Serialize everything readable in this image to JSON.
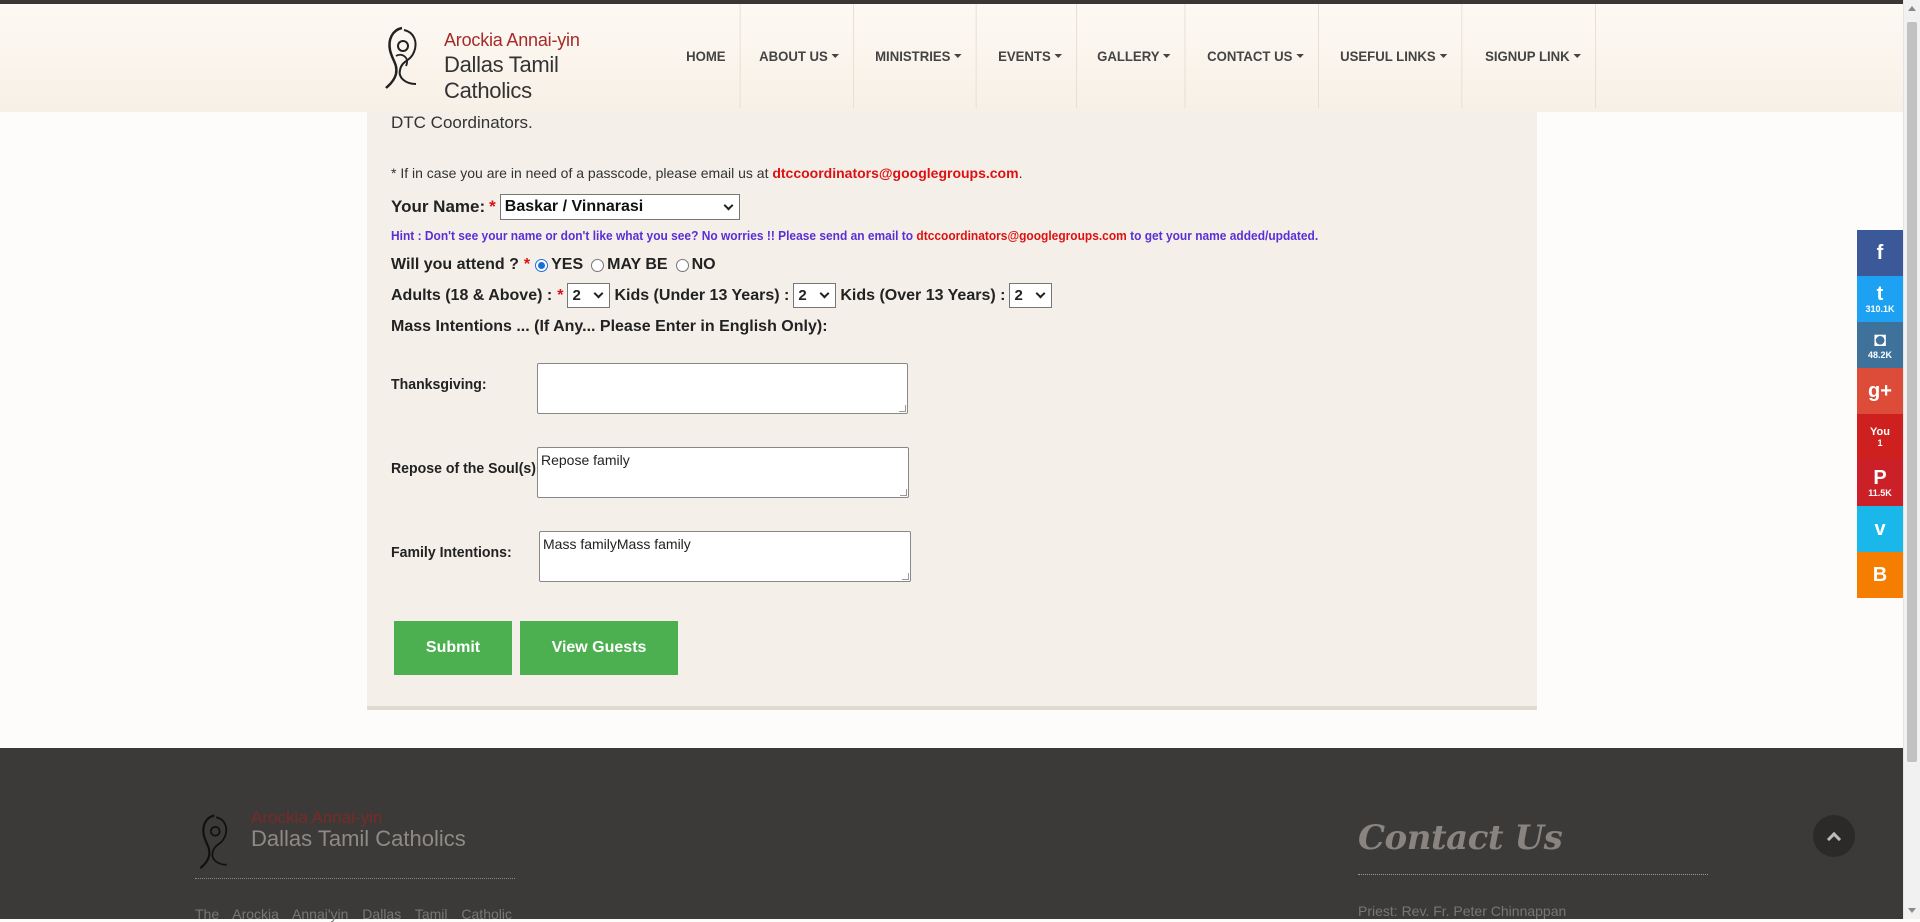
{
  "header": {
    "logo_line1": "Arockia Annai-yin",
    "logo_line2": "Dallas Tamil Catholics",
    "nav": [
      {
        "label": "HOME",
        "caret": false
      },
      {
        "label": "ABOUT US",
        "caret": true
      },
      {
        "label": "MINISTRIES",
        "caret": true
      },
      {
        "label": "EVENTS",
        "caret": true
      },
      {
        "label": "GALLERY",
        "caret": true
      },
      {
        "label": "CONTACT US",
        "caret": true
      },
      {
        "label": "USEFUL LINKS",
        "caret": true
      },
      {
        "label": "SIGNUP LINK",
        "caret": true
      }
    ]
  },
  "form": {
    "intro_text": "DTC Coordinators.",
    "passcode_note": "* If in case you are in need of a passcode, please email us at",
    "passcode_email": "dtccoordinators@googlegroups.com",
    "passcode_end": ".",
    "name_label": "Your Name:",
    "required_mark": "*",
    "name_value": "Baskar / Vinnarasi",
    "hint_pre": "Hint : Don't see your name or don't like what you see? No worries !! Please send an email to",
    "hint_email": "dtccoordinators@googlegroups.com",
    "hint_post": "to get your name added/updated.",
    "attend_label": "Will you attend ?",
    "attend_options": [
      "YES",
      "MAY BE",
      "NO"
    ],
    "attend_selected": "YES",
    "adults_label": "Adults (18 & Above) :",
    "adults_value": "2",
    "kids_under_label": "Kids (Under 13 Years) :",
    "kids_under_value": "2",
    "kids_over_label": "Kids (Over 13 Years) :",
    "kids_over_value": "2",
    "mass_title": "Mass Intentions ... (If Any... Please Enter in English Only):",
    "thanksgiving_label": "Thanksgiving:",
    "thanksgiving_value": "",
    "repose_label": "Repose of the Soul(s):",
    "repose_value": "Repose family",
    "family_label": "Family Intentions:",
    "family_value": "Mass familyMass family",
    "submit_label": "Submit",
    "view_guests_label": "View Guests"
  },
  "social": [
    {
      "name": "facebook-icon",
      "glyph": "f",
      "count": "",
      "color": "#3b5998"
    },
    {
      "name": "twitter-icon",
      "glyph": "t",
      "count": "310.1K",
      "color": "#1da1f2"
    },
    {
      "name": "instagram-icon",
      "glyph": "◘",
      "count": "48.2K",
      "color": "#3f729b"
    },
    {
      "name": "google-plus-icon",
      "glyph": "g+",
      "count": "",
      "color": "#dd4b39"
    },
    {
      "name": "youtube-icon",
      "glyph": "You",
      "count": "1",
      "color": "#cd201f"
    },
    {
      "name": "pinterest-icon",
      "glyph": "P",
      "count": "11.5K",
      "color": "#cb2027"
    },
    {
      "name": "vimeo-icon",
      "glyph": "v",
      "count": "",
      "color": "#1ab7ea"
    },
    {
      "name": "blogger-icon",
      "glyph": "B",
      "count": "",
      "color": "#f57d00"
    }
  ],
  "footer": {
    "logo_line1": "Arockia Annai-yin",
    "logo_line2": "Dallas Tamil Catholics",
    "about_text": "The Arockia Annai'yin Dallas Tamil Catholic",
    "contact_heading": "Contact Us",
    "priest_text": "Priest: Rev. Fr. Peter Chinnappan"
  }
}
